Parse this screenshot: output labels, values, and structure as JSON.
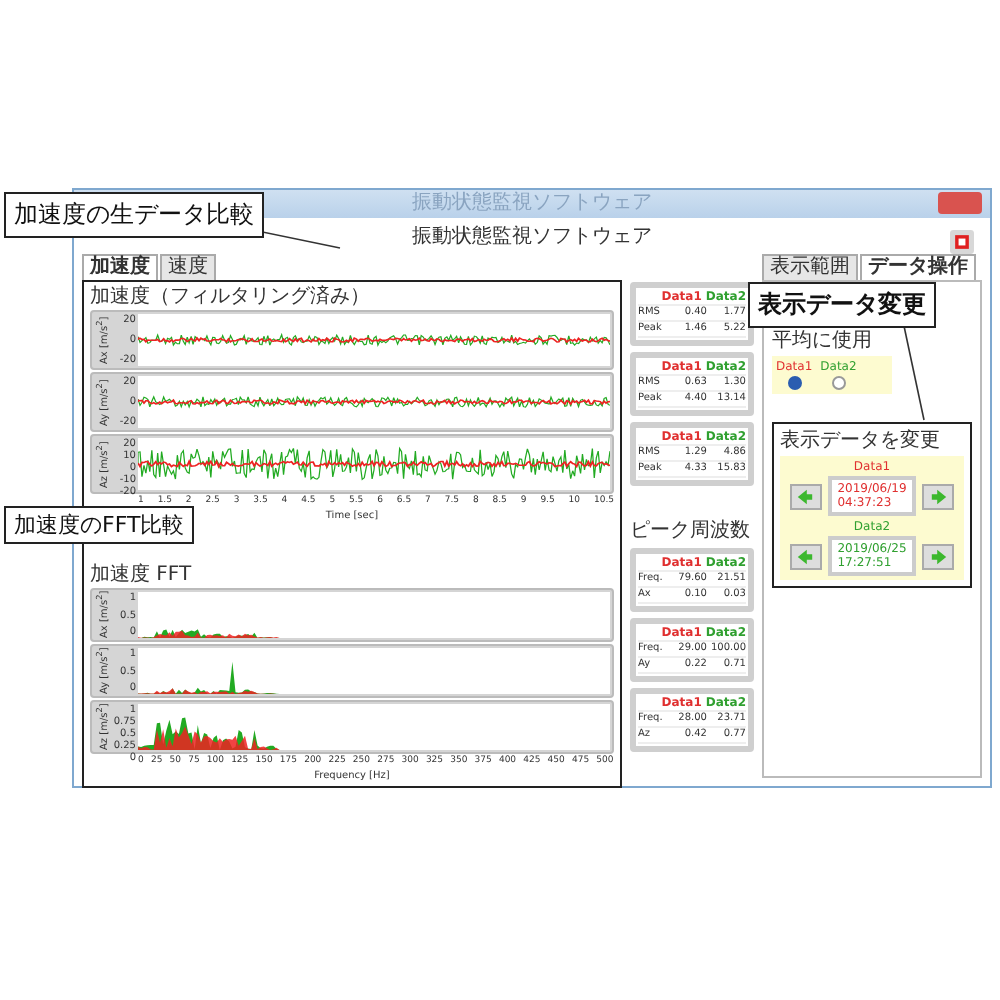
{
  "window": {
    "title": "振動状態監視ソフトウェア"
  },
  "app_title": "振動状態監視ソフトウェア",
  "tabs": [
    {
      "label": "加速度",
      "selected": true
    },
    {
      "label": "速度",
      "selected": false
    }
  ],
  "time_group": {
    "title": "加速度（フィルタリング済み）",
    "xlabel": "Time [sec]",
    "xticks": [
      "1",
      "1.5",
      "2",
      "2.5",
      "3",
      "3.5",
      "4",
      "4.5",
      "5",
      "5.5",
      "6",
      "6.5",
      "7",
      "7.5",
      "8",
      "8.5",
      "9",
      "9.5",
      "10",
      "10.5"
    ],
    "charts": [
      {
        "ylabel": "Ax [m/s$^{2}$]",
        "yticks": [
          "20",
          "0",
          "-20"
        ]
      },
      {
        "ylabel": "Ay [m/s$^{2}$]",
        "yticks": [
          "20",
          "0",
          "-20"
        ]
      },
      {
        "ylabel": "Az [m/s$^{2}$]",
        "yticks": [
          "20",
          "10",
          "0",
          "-10",
          "-20"
        ]
      }
    ]
  },
  "fft_group": {
    "title": "加速度 FFT",
    "xlabel": "Frequency [Hz]",
    "xticks": [
      "0",
      "25",
      "50",
      "75",
      "100",
      "125",
      "150",
      "175",
      "200",
      "225",
      "250",
      "275",
      "300",
      "325",
      "350",
      "375",
      "400",
      "425",
      "450",
      "475",
      "500"
    ],
    "charts": [
      {
        "ylabel": "Ax [m/s$^{2}$]",
        "yticks": [
          "1",
          "0.5",
          "0"
        ]
      },
      {
        "ylabel": "Ay [m/s$^{2}$]",
        "yticks": [
          "1",
          "0.5",
          "0"
        ]
      },
      {
        "ylabel": "Az [m/s$^{2}$]",
        "yticks": [
          "1",
          "0.75",
          "0.5",
          "0.25",
          "0"
        ]
      }
    ]
  },
  "stats": [
    {
      "columns": [
        {
          "label": "Data1",
          "color": "#e03030"
        },
        {
          "label": "Data2",
          "color": "#30a030"
        }
      ],
      "rows": [
        {
          "label": "RMS",
          "values": [
            "0.40",
            "1.77"
          ]
        },
        {
          "label": "Peak",
          "values": [
            "1.46",
            "5.22"
          ]
        }
      ]
    },
    {
      "columns": [
        {
          "label": "Data1",
          "color": "#e03030"
        },
        {
          "label": "Data2",
          "color": "#30a030"
        }
      ],
      "rows": [
        {
          "label": "RMS",
          "values": [
            "0.63",
            "1.30"
          ]
        },
        {
          "label": "Peak",
          "values": [
            "4.40",
            "13.14"
          ]
        }
      ]
    },
    {
      "columns": [
        {
          "label": "Data1",
          "color": "#e03030"
        },
        {
          "label": "Data2",
          "color": "#30a030"
        }
      ],
      "rows": [
        {
          "label": "RMS",
          "values": [
            "1.29",
            "4.86"
          ]
        },
        {
          "label": "Peak",
          "values": [
            "4.33",
            "15.83"
          ]
        }
      ]
    }
  ],
  "peak_frequency": {
    "title": "ピーク周波数",
    "tables": [
      {
        "columns": [
          {
            "label": "Data1",
            "color": "#e03030"
          },
          {
            "label": "Data2",
            "color": "#30a030"
          }
        ],
        "rows": [
          {
            "label": "Freq.",
            "values": [
              "79.60",
              "21.51"
            ]
          },
          {
            "label": "Ax",
            "values": [
              "0.10",
              "0.03"
            ]
          }
        ]
      },
      {
        "columns": [
          {
            "label": "Data1",
            "color": "#e03030"
          },
          {
            "label": "Data2",
            "color": "#30a030"
          }
        ],
        "rows": [
          {
            "label": "Freq.",
            "values": [
              "29.00",
              "100.00"
            ]
          },
          {
            "label": "Ay",
            "values": [
              "0.22",
              "0.71"
            ]
          }
        ]
      },
      {
        "columns": [
          {
            "label": "Data1",
            "color": "#e03030"
          },
          {
            "label": "Data2",
            "color": "#30a030"
          }
        ],
        "rows": [
          {
            "label": "Freq.",
            "values": [
              "28.00",
              "23.71"
            ]
          },
          {
            "label": "Az",
            "values": [
              "0.42",
              "0.77"
            ]
          }
        ]
      }
    ]
  },
  "right_panel": {
    "tabs": [
      {
        "label": "表示範囲",
        "selected": false
      },
      {
        "label": "データ操作",
        "selected": true
      }
    ],
    "average": {
      "title": "平均に使用",
      "options": [
        {
          "label": "Data1",
          "color": "#e03030",
          "selected": true
        },
        {
          "label": "Data2",
          "color": "#30a030",
          "selected": false
        }
      ]
    },
    "change": {
      "title": "表示データを変更",
      "items": [
        {
          "label": "Data1",
          "color": "#e03030",
          "date": "2019/06/19",
          "time": "04:37:23"
        },
        {
          "label": "Data2",
          "color": "#30a030",
          "date": "2019/06/25",
          "time": "17:27:51"
        }
      ]
    }
  },
  "annotations": [
    {
      "text": "加速度の生データ比較"
    },
    {
      "text": "加速度のFFT比較"
    },
    {
      "text": "表示データ変更"
    }
  ]
}
